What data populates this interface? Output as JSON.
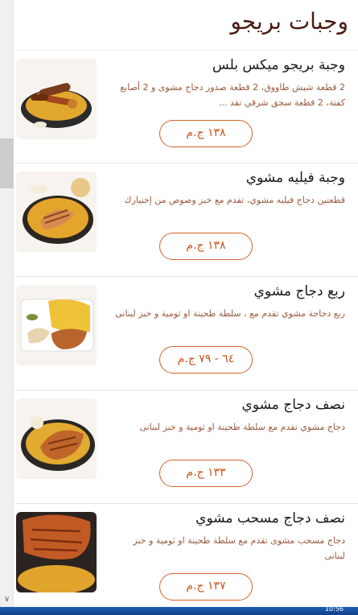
{
  "page": {
    "title": "وجبات بريجو"
  },
  "meals": [
    {
      "name": "وجبة بريجو ميكس بلس",
      "description": "2 قطعة شيش طاووق، 2 قطعة صدور دجاج مشوى و 2 أصابع كفتة، 2 قطعة سجق شرقي تقد ...",
      "price": "١٣٨ ج.م",
      "image": "mixed-grill-platter"
    },
    {
      "name": "وجبة فيليه مشوي",
      "description": "قطعتين دجاج فيليه مشوي، تقدم مع خبز وصوص من إختيارك",
      "price": "١٣٨ ج.م",
      "image": "grilled-fillet-rice"
    },
    {
      "name": "ربع دجاج مشوي",
      "description": "ربع دجاجة مشوي تقدم مع ، سلطة طحينة او ثومية و خبز لبنانى",
      "price": "٦٤ - ٧٩ ج.م",
      "image": "quarter-chicken-plate"
    },
    {
      "name": "نصف دجاج مشوي",
      "description": "دجاج مشوي تقدم مع سلطة طحينة او ثومية و خبز لبنانى",
      "price": "١٣٣ ج.م",
      "image": "half-chicken-plate"
    },
    {
      "name": "نصف دجاج مسحب مشوي",
      "description": "دجاج مسحب مشوى تقدم مع سلطة طحينة او ثومية و خبز لبنانى",
      "price": "١٣٧ ج.م",
      "image": "butterfly-chicken-plate"
    }
  ],
  "colors": {
    "accent": "#d4622a",
    "title": "#4a1c12",
    "description": "#9a5a3e"
  }
}
